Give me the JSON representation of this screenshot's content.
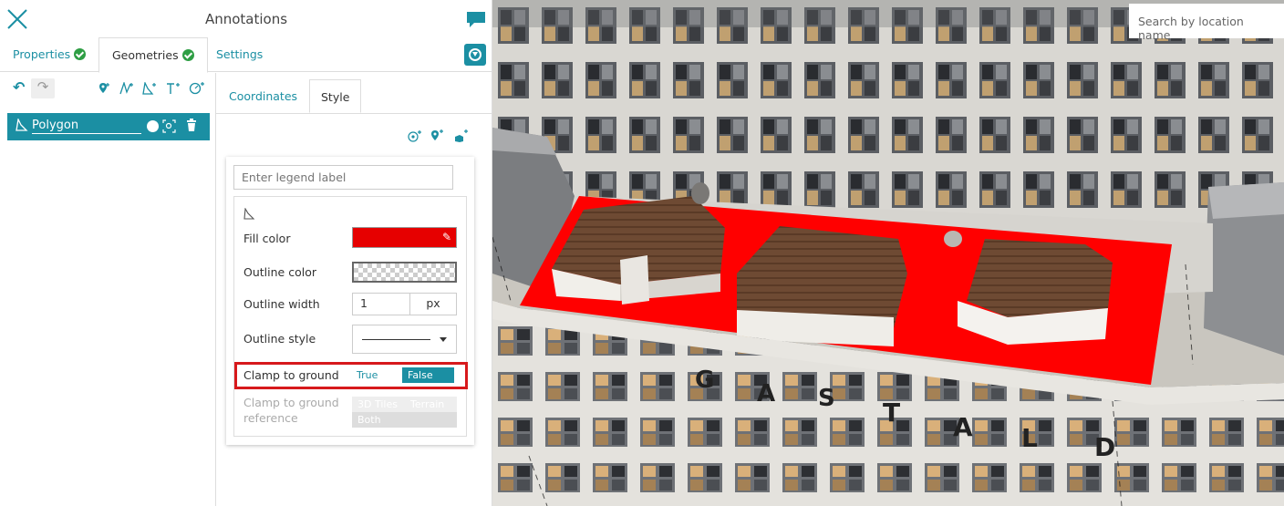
{
  "panel": {
    "title": "Annotations",
    "tabs": [
      {
        "label": "Properties",
        "checked": true
      },
      {
        "label": "Geometries",
        "checked": true,
        "active": true
      },
      {
        "label": "Settings"
      }
    ]
  },
  "geometry_list": {
    "items": [
      {
        "label": "Polygon",
        "selected": true
      }
    ],
    "toolbar_icons": [
      "undo-icon",
      "redo-icon",
      "add-point-icon",
      "add-line-icon",
      "add-polygon-icon",
      "add-text-icon",
      "add-circle-icon"
    ]
  },
  "sub_tabs": [
    {
      "label": "Coordinates"
    },
    {
      "label": "Style",
      "active": true
    }
  ],
  "style": {
    "legend_placeholder": "Enter legend label",
    "fill_color_label": "Fill color",
    "fill_color": "#e60000",
    "outline_color_label": "Outline color",
    "outline_width_label": "Outline width",
    "outline_width_value": "1",
    "outline_width_unit": "px",
    "outline_style_label": "Outline style",
    "outline_style_value": "solid",
    "clamp_label": "Clamp to ground",
    "clamp_options": [
      "True",
      "False"
    ],
    "clamp_selected": "False",
    "clamp_ref_label": "Clamp to ground reference",
    "clamp_ref_options": [
      "3D Tiles",
      "Terrain",
      "Both"
    ],
    "clamp_ref_selected": "Both"
  },
  "map": {
    "search_placeholder": "Search by location name",
    "building_letters": [
      "G",
      "A",
      "S",
      "T",
      "A",
      "L",
      "D"
    ]
  },
  "colors": {
    "accent": "#1b8fa3",
    "polygon_fill": "#ff0000",
    "highlight": "#d7191c"
  }
}
